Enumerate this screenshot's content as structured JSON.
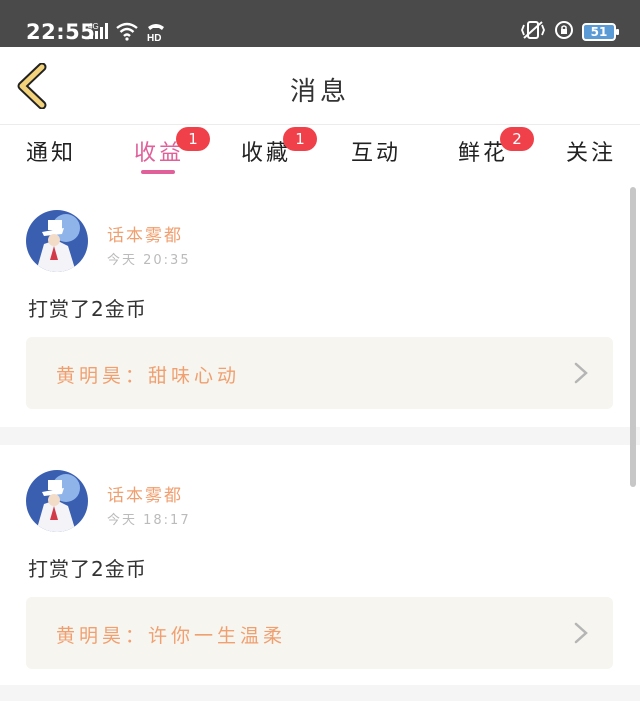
{
  "status_bar": {
    "time": "22:55",
    "network": "4G",
    "hd_label": "HD",
    "battery": "51"
  },
  "header": {
    "title": "消息"
  },
  "tabs": [
    {
      "label": "通知",
      "badge": null,
      "active": false
    },
    {
      "label": "收益",
      "badge": "1",
      "active": true
    },
    {
      "label": "收藏",
      "badge": "1",
      "active": false
    },
    {
      "label": "互动",
      "badge": null,
      "active": false
    },
    {
      "label": "鲜花",
      "badge": "2",
      "active": false
    },
    {
      "label": "关注",
      "badge": null,
      "active": false
    }
  ],
  "messages": [
    {
      "user": "话本雾都",
      "time": "今天 20:35",
      "text": "打赏了2金币",
      "book": "黄明昊：甜味心动"
    },
    {
      "user": "话本雾都",
      "time": "今天 18:17",
      "text": "打赏了2金币",
      "book": "黄明昊：许你一生温柔"
    }
  ],
  "colors": {
    "accent": "#e0609a",
    "badge": "#f0414a",
    "name": "#f0a070",
    "back_arrow": "#f2d27a"
  }
}
